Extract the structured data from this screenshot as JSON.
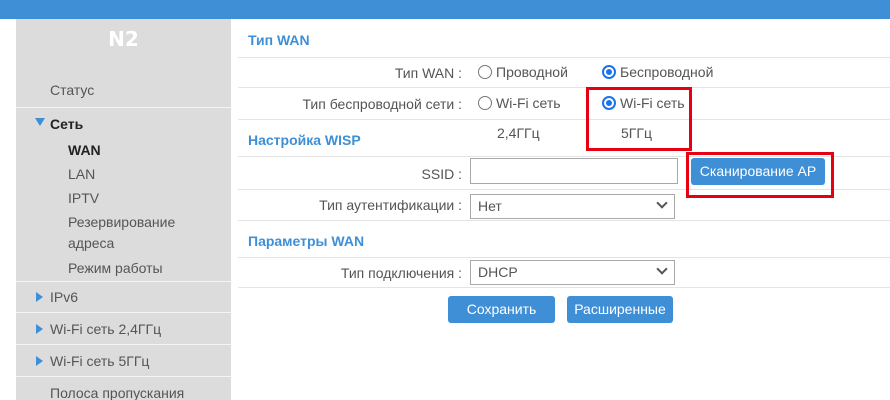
{
  "sidebar": {
    "model": "N2",
    "items": [
      {
        "label": "Статус"
      },
      {
        "label": "Сеть"
      },
      {
        "label": "WAN"
      },
      {
        "label": "LAN"
      },
      {
        "label": "IPTV"
      },
      {
        "label": "Резервирование"
      },
      {
        "label": "адреса"
      },
      {
        "label": "Режим работы"
      },
      {
        "label": "IPv6"
      },
      {
        "label": "Wi-Fi сеть 2,4ГГц"
      },
      {
        "label": "Wi-Fi сеть 5ГГц"
      },
      {
        "label": "Полоса пропускания"
      }
    ]
  },
  "wan_type": {
    "section_title": "Тип WAN",
    "label": "Тип WAN :",
    "options": [
      "Проводной",
      "Беспроводной"
    ],
    "selected": "Беспроводной"
  },
  "wireless_type": {
    "label": "Тип беспроводной сети :",
    "options": [
      "Wi-Fi сеть",
      "Wi-Fi сеть"
    ],
    "bands": [
      "2,4ГГц",
      "5ГГц"
    ],
    "selected_index": 1
  },
  "wisp": {
    "section_title": "Настройка WISP",
    "ssid_label": "SSID :",
    "ssid_value": "",
    "scan_button": "Сканирование AP",
    "auth_label": "Тип аутентификации :",
    "auth_value": "Нет"
  },
  "wan_params": {
    "section_title": "Параметры WAN",
    "conn_label": "Тип подключения :",
    "conn_value": "DHCP"
  },
  "actions": {
    "save": "Сохранить",
    "advanced": "Расширенные"
  },
  "colors": {
    "accent": "#3e8fd6",
    "highlight": "#e60012",
    "sidebar_bg": "#dcdcdc"
  }
}
